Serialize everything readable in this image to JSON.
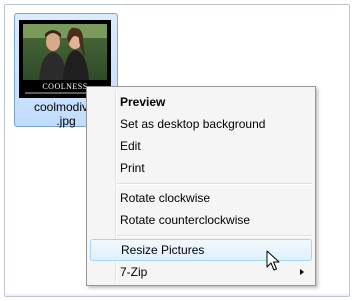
{
  "file": {
    "name_line1": "coolmodivat",
    "name_line2": ".jpg",
    "thumbnail_caption": "COOLNESS"
  },
  "context_menu": {
    "items": [
      {
        "label": "Preview"
      },
      {
        "label": "Set as desktop background"
      },
      {
        "label": "Edit"
      },
      {
        "label": "Print"
      },
      {
        "label": "Rotate clockwise"
      },
      {
        "label": "Rotate counterclockwise"
      },
      {
        "label": "Resize Pictures"
      },
      {
        "label": "7-Zip"
      }
    ]
  },
  "colors": {
    "selection_fill": "#c1dcfc",
    "selection_border": "#7da2ce",
    "menu_background": "#f5f5f5",
    "menu_highlight": "#ddf0fb"
  },
  "icons": [
    "submenu-arrow-icon",
    "mouse-pointer-icon"
  ]
}
